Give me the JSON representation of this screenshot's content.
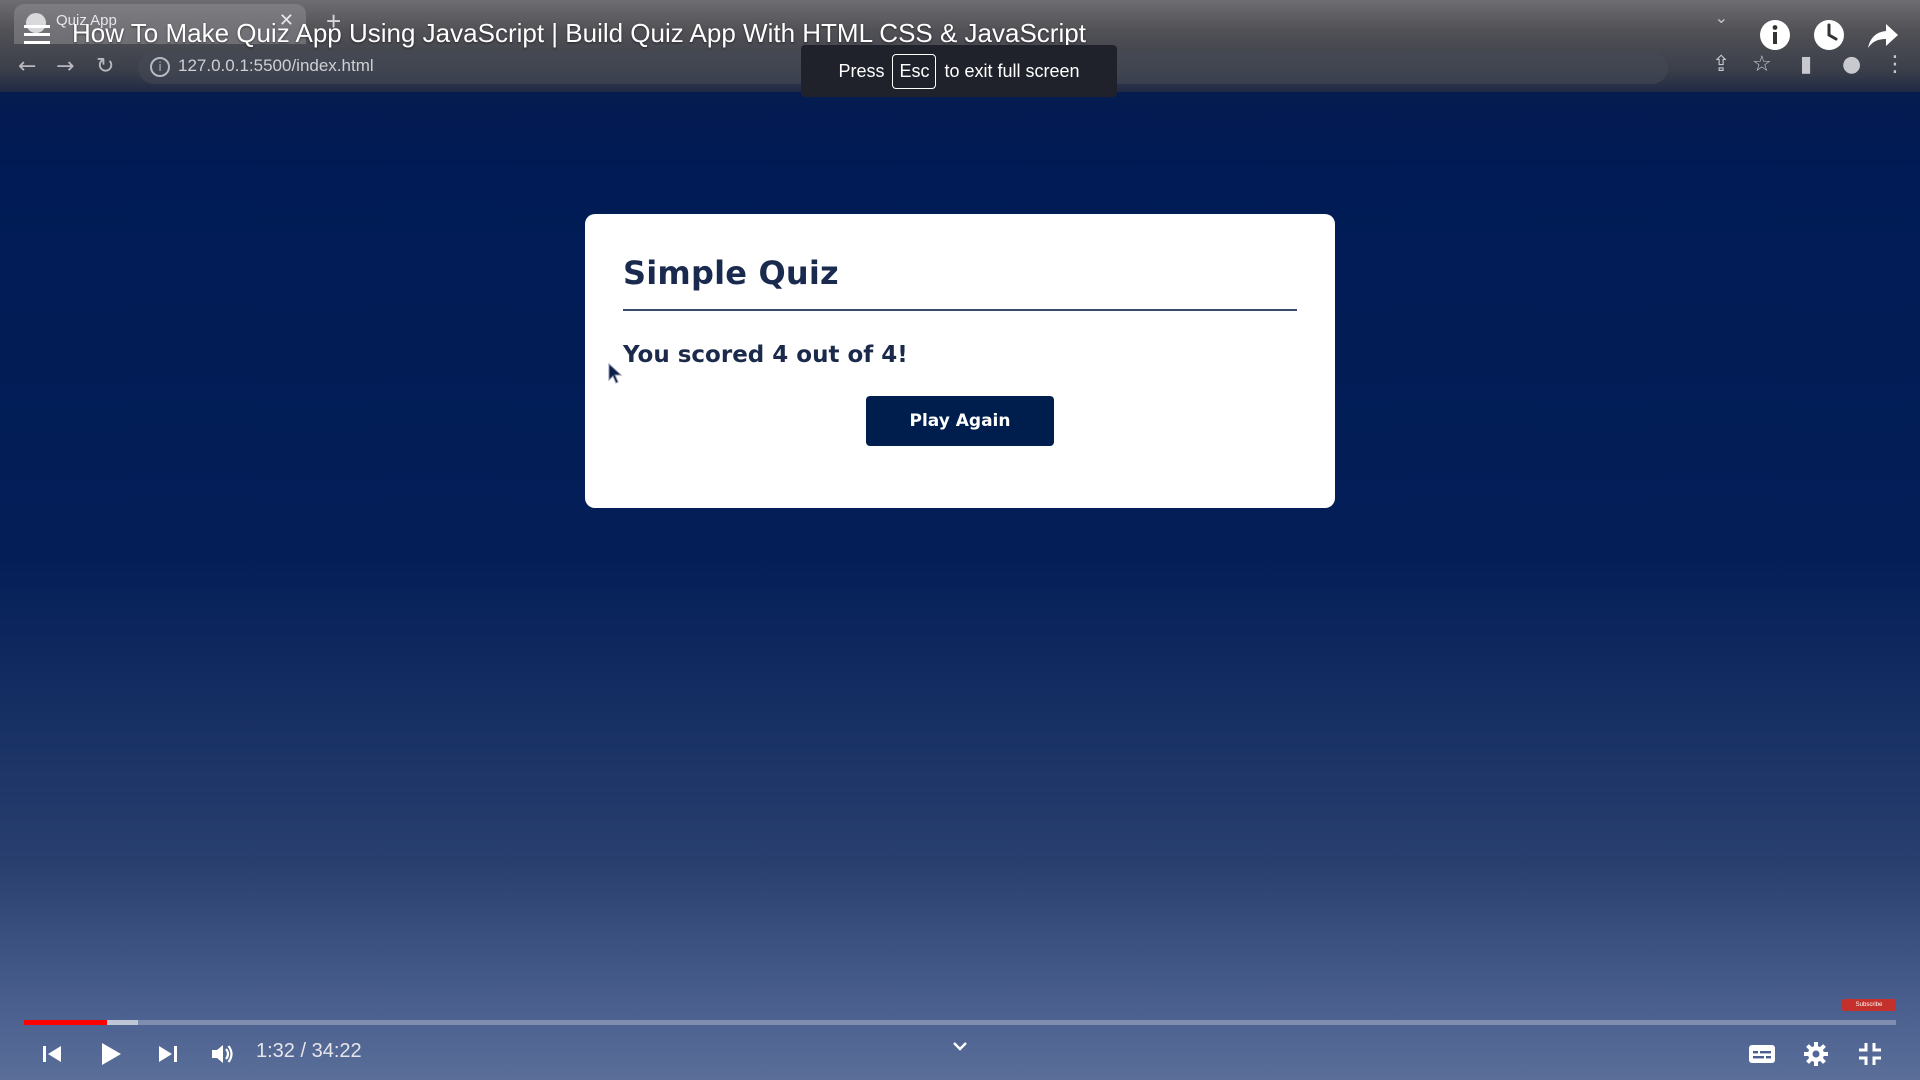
{
  "browser": {
    "tab_title": "Quiz App",
    "url": "127.0.0.1:5500/index.html"
  },
  "video": {
    "title": "How To Make Quiz App Using JavaScript | Build Quiz App With HTML CSS & JavaScript",
    "fullscreen_notice": {
      "before": "Press",
      "key": "Esc",
      "after": "to exit full screen"
    },
    "current_time": "1:32",
    "duration": "34:22",
    "time_display": "1:32 / 34:22",
    "progress_fraction": 0.0446,
    "buffered_fraction": 0.061,
    "watermark": "Subscribe"
  },
  "quiz": {
    "title": "Simple Quiz",
    "score_text": "You scored 4 out of 4!",
    "play_again_label": "Play Again"
  },
  "colors": {
    "quiz_primary": "#001e4d",
    "progress_red": "#ff0000",
    "background_top": "#001b55",
    "background_bottom": "#5a6e99"
  },
  "icons": {
    "menu": "playlist-menu-icon",
    "info": "info-icon",
    "watch_later": "clock-icon",
    "share": "share-arrow-icon",
    "prev": "skip-previous-icon",
    "play": "play-icon",
    "next": "skip-next-icon",
    "volume": "volume-icon",
    "captions": "subtitles-icon",
    "settings": "gear-icon",
    "exit_fullscreen": "exit-fullscreen-icon"
  }
}
